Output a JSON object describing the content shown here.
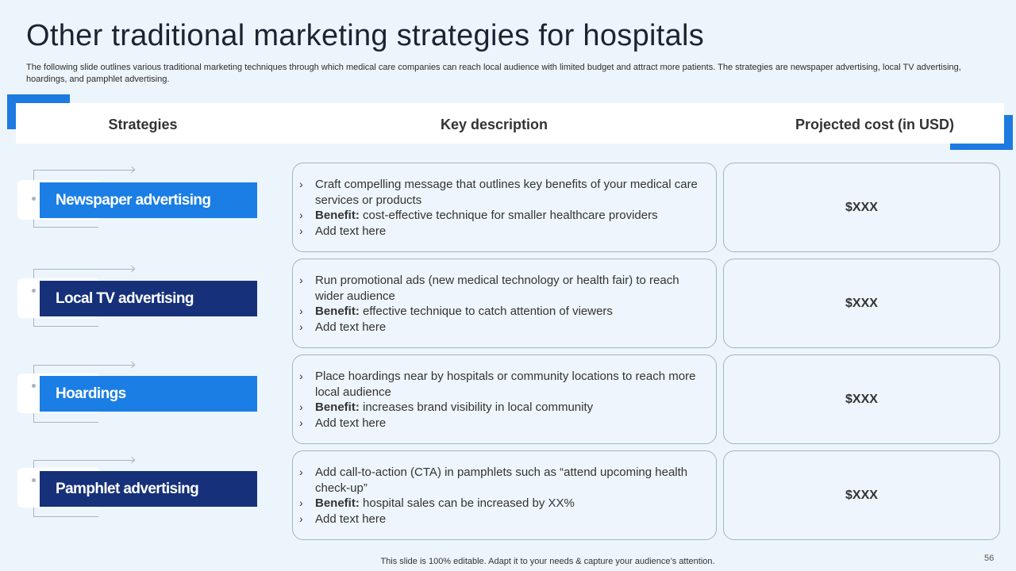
{
  "title": "Other traditional marketing strategies for hospitals",
  "subtitle": "The following slide outlines various traditional marketing techniques through which medical care companies can reach local audience with limited budget and attract more patients. The strategies are newspaper advertising, local TV advertising, hoardings, and pamphlet advertising.",
  "headers": {
    "strategies": "Strategies",
    "description": "Key description",
    "cost": "Projected cost (in USD)"
  },
  "rows": [
    {
      "strategy": "Newspaper advertising",
      "style": "light",
      "point1": "Craft compelling message that outlines key benefits of your medical care services or products",
      "benefit_label": "Benefit:",
      "benefit_text": " cost-effective technique for smaller healthcare providers",
      "point3": "Add text here",
      "cost": "$XXX"
    },
    {
      "strategy": "Local TV advertising",
      "style": "dark",
      "point1": "Run promotional ads (new medical technology or health fair) to reach wider audience",
      "benefit_label": "Benefit:",
      "benefit_text": " effective technique to catch attention of viewers",
      "point3": "Add text here",
      "cost": "$XXX"
    },
    {
      "strategy": "Hoardings",
      "style": "light",
      "point1": "Place hoardings near by hospitals or community locations to reach more local audience",
      "benefit_label": "Benefit:",
      "benefit_text": " increases brand visibility  in local community",
      "point3": "Add text here",
      "cost": "$XXX"
    },
    {
      "strategy": "Pamphlet advertising",
      "style": "dark",
      "point1": "Add call-to-action (CTA) in pamphlets such as “attend upcoming health check-up”",
      "benefit_label": "Benefit:",
      "benefit_text": " hospital sales can be increased by XX%",
      "point3": "Add text here",
      "cost": "$XXX"
    }
  ],
  "bullet_glyph": "›",
  "footer": "This slide is 100% editable. Adapt it to your needs & capture your audience’s attention.",
  "page_number": "56",
  "colors": {
    "background": "#edf5fc",
    "accent_blue": "#1a7ee4",
    "dark_navy": "#16317a"
  }
}
